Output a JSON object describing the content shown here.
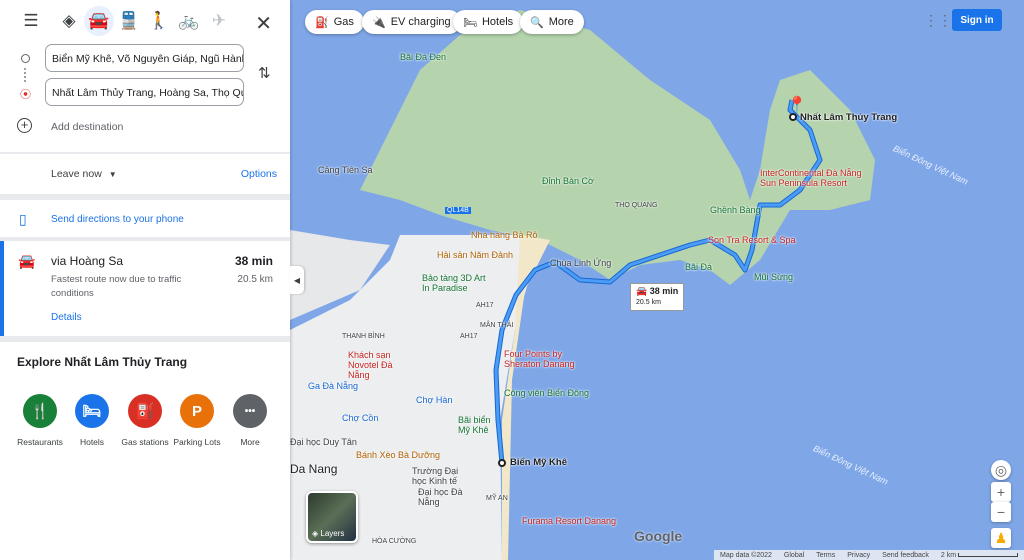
{
  "panel": {
    "modes": [
      {
        "name": "best-route",
        "glyph": "◈"
      },
      {
        "name": "driving",
        "glyph": "🚘"
      },
      {
        "name": "transit",
        "glyph": "🚆"
      },
      {
        "name": "walking",
        "glyph": "🚶"
      },
      {
        "name": "cycling",
        "glyph": "🚲"
      },
      {
        "name": "flight",
        "glyph": "✈"
      }
    ],
    "origin": "Biển Mỹ Khê, Võ Nguyên Giáp, Ngũ Hành Sơn",
    "destination": "Nhất Lâm Thủy Trang, Hoàng Sa, Thọ Quang",
    "add_destination": "Add destination",
    "leave_now": "Leave now",
    "options": "Options",
    "send_directions": "Send directions to your phone",
    "route": {
      "via": "via Hoàng Sa",
      "time": "38 min",
      "note": "Fastest route now due to traffic conditions",
      "distance": "20.5 km",
      "details": "Details"
    },
    "explore_title": "Explore Nhất Lâm Thủy Trang",
    "categories": [
      {
        "label": "Restaurants",
        "icon": "🍴",
        "color": "#188038"
      },
      {
        "label": "Hotels",
        "icon": "🛏",
        "color": "#1a73e8"
      },
      {
        "label": "Gas stations",
        "icon": "⛽",
        "color": "#d93025"
      },
      {
        "label": "Parking Lots",
        "icon": "P",
        "color": "#e8710a"
      },
      {
        "label": "More",
        "icon": "•••",
        "color": "#5f6368"
      }
    ]
  },
  "map": {
    "chips": [
      "Gas",
      "EV charging",
      "Hotels",
      "More"
    ],
    "sign_in": "Sign in",
    "route_badge": {
      "time": "38 min",
      "distance": "20.5 km"
    },
    "labels": [
      "Bãi Đá Đen",
      "Cảng Tiên Sa",
      "Đỉnh Bàn Cờ",
      "THỌ QUANG",
      "QL14B",
      "Nhà hàng Bà Rô",
      "Hải sản Năm Đảnh",
      "Chùa Linh Ứng",
      "Bảo tàng 3D Art In Paradise",
      "AH17",
      "MÂN THÁI",
      "AH17",
      "THANH BÌNH",
      "Khách sạn Novotel Đà Nẵng",
      "Ga Đà Nẵng",
      "Four Points by Sheraton Danang",
      "Công viên Biển Đông",
      "Chợ Hàn",
      "Chợ Cồn",
      "Đại học Duy Tân",
      "Bãi biển Mỹ Khê",
      "Bánh Xèo Bà Dưỡng",
      "Trường Đại học Kinh tế",
      "Đại học Đà Nẵng",
      "MỸ AN",
      "Furama Resort Danang",
      "HÒA CƯỜNG",
      "Da Nang",
      "Nhất Lâm Thủy Trang",
      "InterContinental Đà Nẵng Sun Peninsula Resort",
      "Ghềnh Bàng",
      "Son Tra Resort & Spa",
      "Bãi Đá",
      "Mũi Sừng",
      "Biển Đông Việt Nam",
      "Biển Đông Việt Nam",
      "Biển Mỹ Khê"
    ],
    "layers": "Layers",
    "footer": [
      "Map data ©2022",
      "Global",
      "Terms",
      "Privacy",
      "Send feedback",
      "2 km"
    ],
    "colors": {
      "water": "#7fa7e8",
      "land": "#b5d3ad",
      "city": "#eceef0",
      "route": "#4285f4"
    }
  }
}
